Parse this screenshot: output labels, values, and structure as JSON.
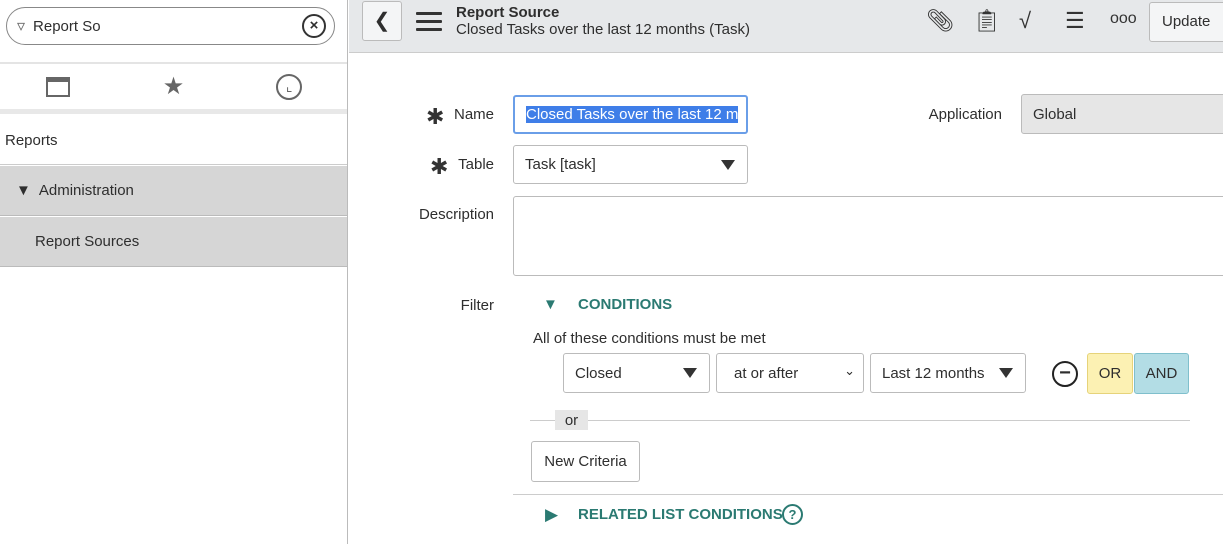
{
  "sidebar": {
    "search_value": "Report So",
    "tabs": [
      "archive-icon",
      "star-icon",
      "clock-icon"
    ],
    "items": [
      {
        "label": "Reports"
      },
      {
        "label": "Administration"
      },
      {
        "label": "Report Sources"
      }
    ]
  },
  "header": {
    "title": "Report Source",
    "subtitle": "Closed Tasks over the last 12 months (Task)",
    "update_label": "Update"
  },
  "form": {
    "name_label": "Name",
    "name_value": "Closed Tasks over the last 12 m",
    "table_label": "Table",
    "table_value": "Task [task]",
    "application_label": "Application",
    "application_value": "Global",
    "description_label": "Description",
    "description_value": "",
    "filter_label": "Filter",
    "conditions_label": "CONDITIONS",
    "conditions_hint": "All of these conditions must be met",
    "condition": {
      "field": "Closed",
      "operator": "at or after",
      "value": "Last 12 months"
    },
    "or_button": "OR",
    "and_button": "AND",
    "or_separator": "or",
    "new_criteria": "New Criteria",
    "related_label": "RELATED LIST CONDITIONS"
  },
  "colors": {
    "accent": "#2b7a72",
    "or": "#fcf1b3",
    "and": "#b3dde5",
    "selection": "#3f7ee8"
  }
}
